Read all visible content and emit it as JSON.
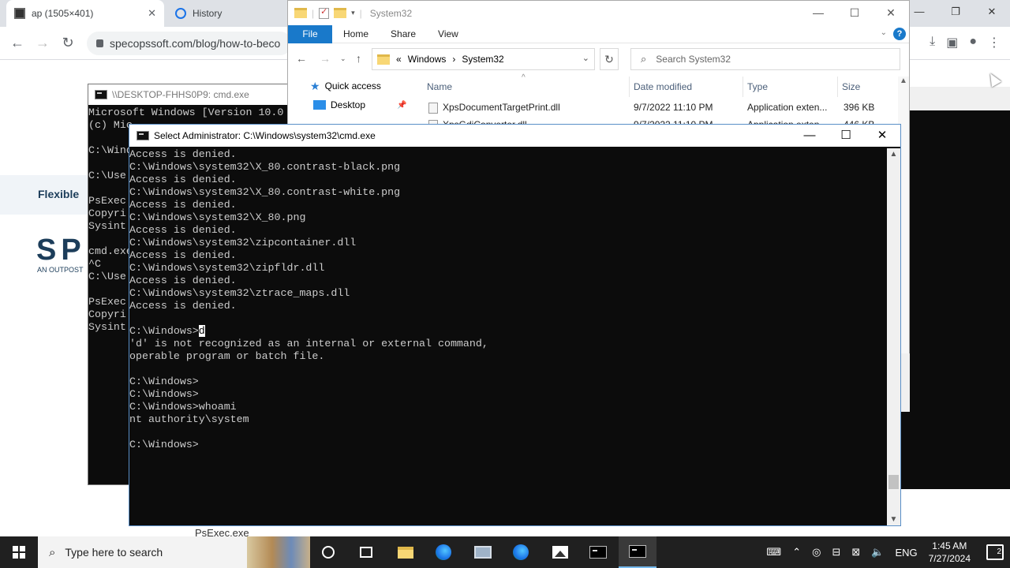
{
  "browser": {
    "tabs": [
      {
        "label": "ap (1505×401)",
        "close": "✕"
      },
      {
        "label": "History"
      }
    ],
    "url": "specopssoft.com/blog/how-to-beco",
    "page": {
      "flexible_text": "Flexible",
      "logo_text": "SP",
      "logo_sub": "AN OUTPOST"
    }
  },
  "cmd_background": {
    "title": "\\\\DESKTOP-FHHS0P9: cmd.exe",
    "lines": [
      "Microsoft Windows [Version 10.0",
      "(c) Mic",
      "",
      "C:\\Wind",
      "",
      "C:\\Use",
      "",
      "PsExec",
      "Copyri",
      "Sysint",
      "",
      "cmd.exe",
      "^C",
      "C:\\Use",
      "",
      "PsExec",
      "Copyri",
      "Sysint"
    ]
  },
  "explorer": {
    "title": "System32",
    "ribbon": {
      "file": "File",
      "home": "Home",
      "share": "Share",
      "view": "View",
      "help": "?"
    },
    "address": {
      "prefix": "«",
      "crumbs": [
        "Windows",
        "System32"
      ]
    },
    "search_placeholder": "Search System32",
    "nav": {
      "quick_access": "Quick access",
      "desktop": "Desktop"
    },
    "columns": {
      "name": "Name",
      "date": "Date modified",
      "type": "Type",
      "size": "Size"
    },
    "rows": [
      {
        "name": "XpsDocumentTargetPrint.dll",
        "date": "9/7/2022 11:10 PM",
        "type": "Application exten...",
        "size": "396 KB"
      },
      {
        "name": "XpsGdiConverter.dll",
        "date": "9/7/2022 11:10 PM",
        "type": "Application exten...",
        "size": "446 KB"
      }
    ]
  },
  "cmd": {
    "title": "Select Administrator: C:\\Windows\\system32\\cmd.exe",
    "lines": [
      "Access is denied.",
      "C:\\Windows\\system32\\X_80.contrast-black.png",
      "Access is denied.",
      "C:\\Windows\\system32\\X_80.contrast-white.png",
      "Access is denied.",
      "C:\\Windows\\system32\\X_80.png",
      "Access is denied.",
      "C:\\Windows\\system32\\zipcontainer.dll",
      "Access is denied.",
      "C:\\Windows\\system32\\zipfldr.dll",
      "Access is denied.",
      "C:\\Windows\\system32\\ztrace_maps.dll",
      "Access is denied.",
      "",
      "C:\\Windows>",
      "'d' is not recognized as an internal or external command,",
      "operable program or batch file.",
      "",
      "C:\\Windows>",
      "C:\\Windows>",
      "C:\\Windows>whoami",
      "nt authority\\system",
      "",
      "C:\\Windows>"
    ],
    "selected_char": "d"
  },
  "behind": {
    "psexec": "PsExec.exe"
  },
  "taskbar": {
    "search_placeholder": "Type here to search",
    "language": "ENG",
    "time": "1:45 AM",
    "date": "7/27/2024",
    "notification_count": "2"
  }
}
